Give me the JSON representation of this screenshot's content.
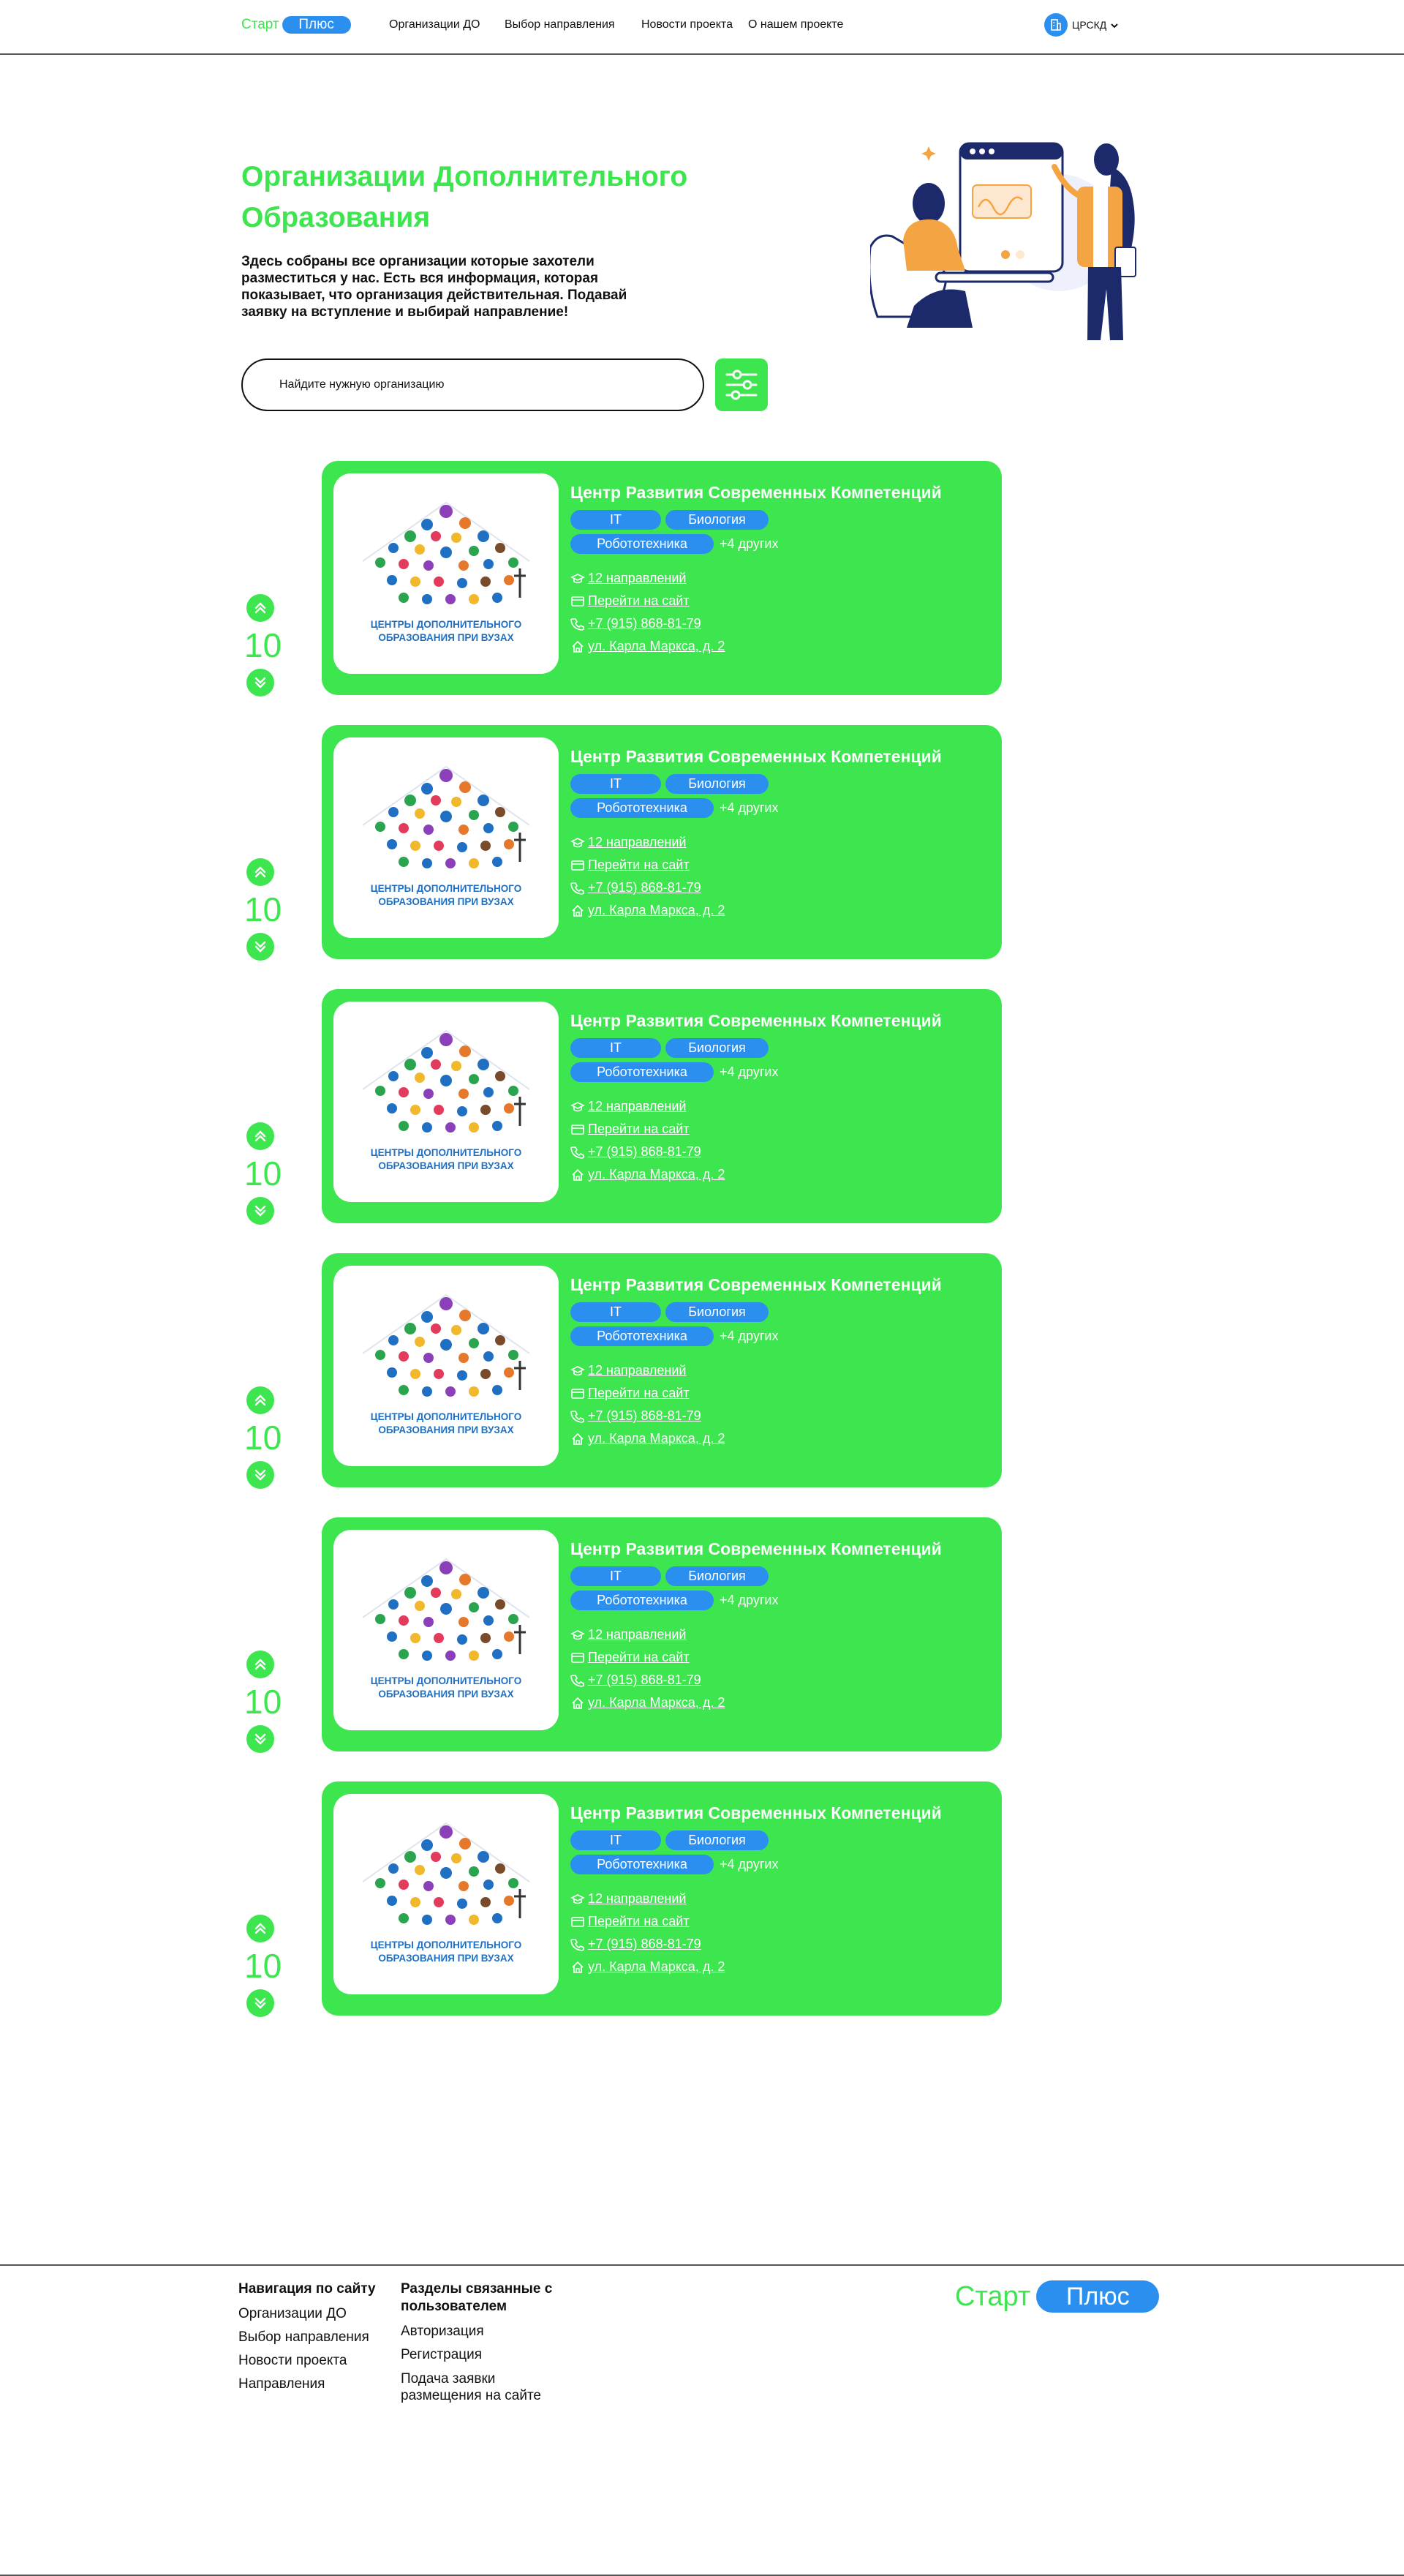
{
  "brand": {
    "part1": "Старт",
    "part2": "Плюс"
  },
  "nav": [
    "Организации ДО",
    "Выбор направления",
    "Новости проекта",
    "О нашем проекте"
  ],
  "region": {
    "label": "ЦРСКД",
    "icon": "building-icon"
  },
  "hero": {
    "title": "Организации Дополнительного Образования",
    "description": "Здесь собраны все организации которые захотели разместиться у нас. Есть вся информация, которая показывает, что организация действительная. Подавай заявку на вступление и выбирай направление!"
  },
  "search": {
    "placeholder": "Найдите нужную организацию"
  },
  "colors": {
    "accent_green": "#3de54f",
    "accent_blue": "#2b8ff0"
  },
  "organizations": [
    {
      "votes": "10",
      "name": "Центр Развития Современных Компетенций",
      "logo_caption": "ЦЕНТРЫ ДОПОЛНИТЕЛЬНОГО ОБРАЗОВАНИЯ ПРИ ВУЗАХ",
      "tags": [
        "IT",
        "Биология",
        "Робототехника"
      ],
      "more": "+4 других",
      "directions": "12 направлений",
      "site": "Перейти на сайт",
      "phone": "+7 (915) 868-81-79",
      "address": "ул. Карла Маркса, д. 2"
    },
    {
      "votes": "10",
      "name": "Центр Развития Современных Компетенций",
      "logo_caption": "ЦЕНТРЫ ДОПОЛНИТЕЛЬНОГО ОБРАЗОВАНИЯ ПРИ ВУЗАХ",
      "tags": [
        "IT",
        "Биология",
        "Робототехника"
      ],
      "more": "+4 других",
      "directions": "12 направлений",
      "site": "Перейти на сайт",
      "phone": "+7 (915) 868-81-79",
      "address": "ул. Карла Маркса, д. 2"
    },
    {
      "votes": "10",
      "name": "Центр Развития Современных Компетенций",
      "logo_caption": "ЦЕНТРЫ ДОПОЛНИТЕЛЬНОГО ОБРАЗОВАНИЯ ПРИ ВУЗАХ",
      "tags": [
        "IT",
        "Биология",
        "Робототехника"
      ],
      "more": "+4 других",
      "directions": "12 направлений",
      "site": "Перейти на сайт",
      "phone": "+7 (915) 868-81-79",
      "address": "ул. Карла Маркса, д. 2"
    },
    {
      "votes": "10",
      "name": "Центр Развития Современных Компетенций",
      "logo_caption": "ЦЕНТРЫ ДОПОЛНИТЕЛЬНОГО ОБРАЗОВАНИЯ ПРИ ВУЗАХ",
      "tags": [
        "IT",
        "Биология",
        "Робототехника"
      ],
      "more": "+4 других",
      "directions": "12 направлений",
      "site": "Перейти на сайт",
      "phone": "+7 (915) 868-81-79",
      "address": "ул. Карла Маркса, д. 2"
    },
    {
      "votes": "10",
      "name": "Центр Развития Современных Компетенций",
      "logo_caption": "ЦЕНТРЫ ДОПОЛНИТЕЛЬНОГО ОБРАЗОВАНИЯ ПРИ ВУЗАХ",
      "tags": [
        "IT",
        "Биология",
        "Робототехника"
      ],
      "more": "+4 других",
      "directions": "12 направлений",
      "site": "Перейти на сайт",
      "phone": "+7 (915) 868-81-79",
      "address": "ул. Карла Маркса, д. 2"
    },
    {
      "votes": "10",
      "name": "Центр Развития Современных Компетенций",
      "logo_caption": "ЦЕНТРЫ ДОПОЛНИТЕЛЬНОГО ОБРАЗОВАНИЯ ПРИ ВУЗАХ",
      "tags": [
        "IT",
        "Биология",
        "Робототехника"
      ],
      "more": "+4 других",
      "directions": "12 направлений",
      "site": "Перейти на сайт",
      "phone": "+7 (915) 868-81-79",
      "address": "ул. Карла Маркса, д. 2"
    }
  ],
  "footer": {
    "nav_title": "Навигация по сайту",
    "nav_links": [
      "Организации ДО",
      "Выбор направления",
      "Новости проекта",
      "Направления"
    ],
    "user_title": "Разделы связанные с пользователем",
    "user_links": [
      "Авторизация",
      "Регистрация",
      "Подача заявки размещения на сайте"
    ]
  }
}
